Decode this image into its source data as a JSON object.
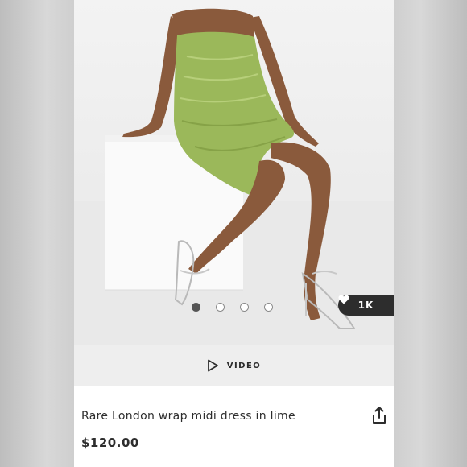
{
  "product": {
    "title": "Rare London wrap midi dress in lime",
    "price": "$120.00",
    "dress_color": "#9bb85a"
  },
  "gallery": {
    "slide_count": 4,
    "active_slide": 1,
    "likes_count": "1K",
    "likes_icon": "heart-icon"
  },
  "video": {
    "label": "VIDEO",
    "icon": "play-icon"
  },
  "actions": {
    "share_icon": "share-icon"
  }
}
